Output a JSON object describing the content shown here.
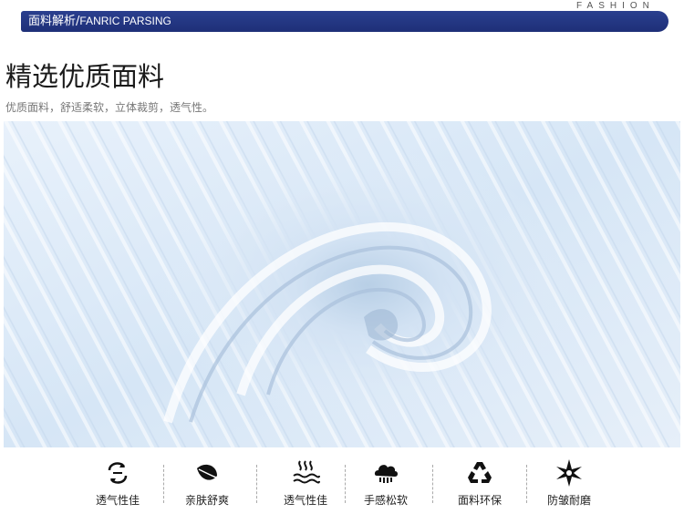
{
  "corner_tag": "FASHION",
  "header": {
    "title_cn": "面料解析/",
    "title_en": "FANRIC PARSING"
  },
  "title": "精选优质面料",
  "subtitle": "优质面料，舒适柔软，立体裁剪，透气性。",
  "photo": {
    "subject": "light-blue-knit-fabric-swirl"
  },
  "features": [
    {
      "icon": "breathable-swirl-icon",
      "label": "透气性佳"
    },
    {
      "icon": "leaf-icon",
      "label": "亲肤舒爽"
    },
    {
      "icon": "heat-waves-icon",
      "label": "透气性佳"
    },
    {
      "icon": "cloud-hand-icon",
      "label": "手感松软"
    },
    {
      "icon": "recycle-icon",
      "label": "面料环保"
    },
    {
      "icon": "star-burst-icon",
      "label": "防皱耐磨"
    }
  ],
  "colors": {
    "header_bar": "#1e2f78",
    "fabric": "#dce9f7"
  }
}
